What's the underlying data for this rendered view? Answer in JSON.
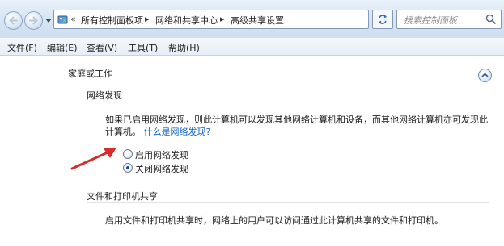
{
  "address": {
    "crumbs": [
      "所有控制面板项",
      "网络和共享中心",
      "高级共享设置"
    ],
    "search_placeholder": "搜索控制面板"
  },
  "menu": [
    "文件(F)",
    "编辑(E)",
    "查看(V)",
    "工具(T)",
    "帮助(H)"
  ],
  "profile": {
    "header": "家庭或工作",
    "network_discovery": {
      "title": "网络发现",
      "desc_line1": "如果已启用网络发现，则此计算机可以发现其他网络计算机和设备，而其他网络计算机亦可发现此",
      "desc_line2": "计算机。",
      "link": "什么是网络发现?",
      "options": [
        {
          "label": "启用网络发现",
          "checked": false
        },
        {
          "label": "关闭网络发现",
          "checked": true
        }
      ]
    },
    "file_printer_sharing": {
      "title": "文件和打印机共享",
      "desc": "启用文件和打印机共享时，网络上的用户可以访问通过此计算机共享的文件和打印机。"
    }
  },
  "colors": {
    "link": "#0a5fc9",
    "annotation_arrow": "#d92b2b",
    "window_chrome": "#d6e4f3"
  }
}
